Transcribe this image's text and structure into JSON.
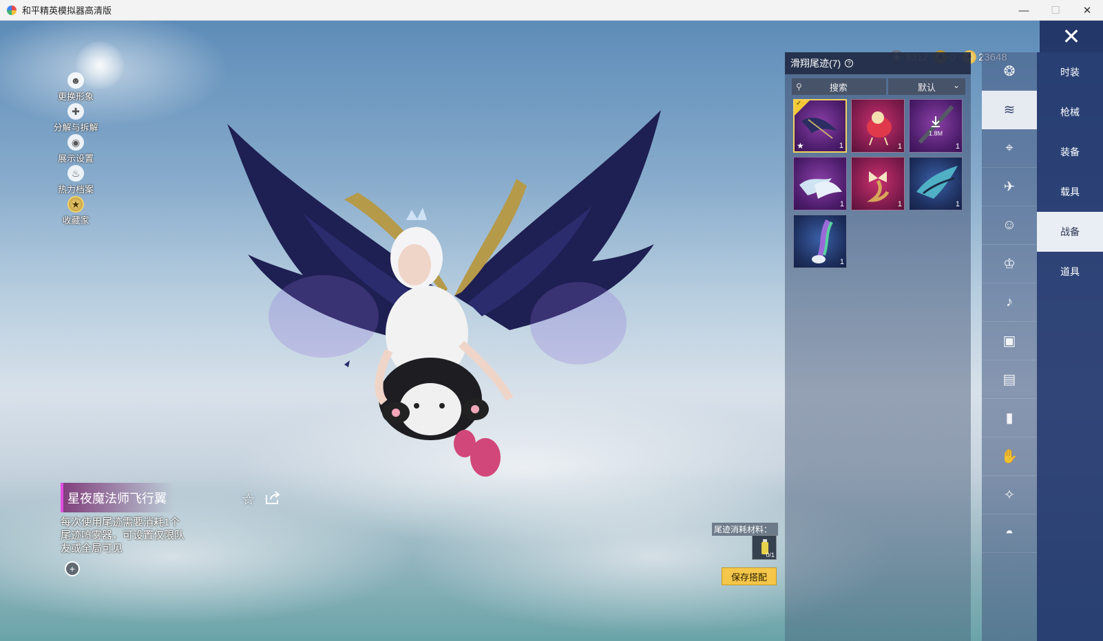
{
  "window": {
    "title": "和平精英模拟器高清版",
    "controls": {
      "minimize": "—",
      "maximize": "☐",
      "close": "✕"
    }
  },
  "currency": [
    {
      "icon": "ticket-coin-icon",
      "value": "9312"
    },
    {
      "icon": "uc-coin-icon",
      "value": "0"
    },
    {
      "icon": "gold-coin-icon",
      "value": "23648"
    }
  ],
  "side_menu": [
    {
      "label": "更换形象",
      "icon": "person-icon"
    },
    {
      "label": "分解与拆解",
      "icon": "puzzle-icon"
    },
    {
      "label": "展示设置",
      "icon": "eye-icon"
    },
    {
      "label": "热力档案",
      "icon": "flame-icon"
    },
    {
      "label": "收藏家",
      "icon": "collector-badge-icon"
    }
  ],
  "item": {
    "name": "星夜魔法师飞行翼",
    "description": "每次使用尾迹需要消耗1个尾迹喷雾器，可设置仅限队友或全局可见"
  },
  "panel": {
    "title": "滑翔尾迹(7)",
    "search_label": "搜索",
    "sort_label": "默认",
    "items": [
      {
        "name": "dark-wings-trail",
        "rarity": "purple",
        "count": "1",
        "selected": true,
        "favorite": true
      },
      {
        "name": "red-chick-trail",
        "rarity": "red",
        "count": "1"
      },
      {
        "name": "download-trail",
        "rarity": "purple",
        "count": "1",
        "download_size": "1.8M"
      },
      {
        "name": "white-wings-trail",
        "rarity": "purple",
        "count": "1"
      },
      {
        "name": "golden-bow-trail",
        "rarity": "red",
        "count": "1"
      },
      {
        "name": "crystal-wings-trail",
        "rarity": "blue",
        "count": "1"
      },
      {
        "name": "rainbow-trail",
        "rarity": "blue",
        "count": "1"
      }
    ]
  },
  "material": {
    "label": "尾迹消耗材料：",
    "count": "0/1"
  },
  "save_button": "保存搭配",
  "category_icons": [
    "pet-icon",
    "glider-trail-icon",
    "drone-icon",
    "plane-icon",
    "emote-icon",
    "avatar-icon",
    "sound-icon",
    "frame-icon",
    "gallery-icon",
    "spray-icon",
    "gesture-icon",
    "sparkle-icon",
    "helmet-icon"
  ],
  "tabs": [
    "时装",
    "枪械",
    "装备",
    "载具",
    "战备",
    "道具"
  ],
  "active_tab": "战备",
  "close_icon": "close-icon"
}
